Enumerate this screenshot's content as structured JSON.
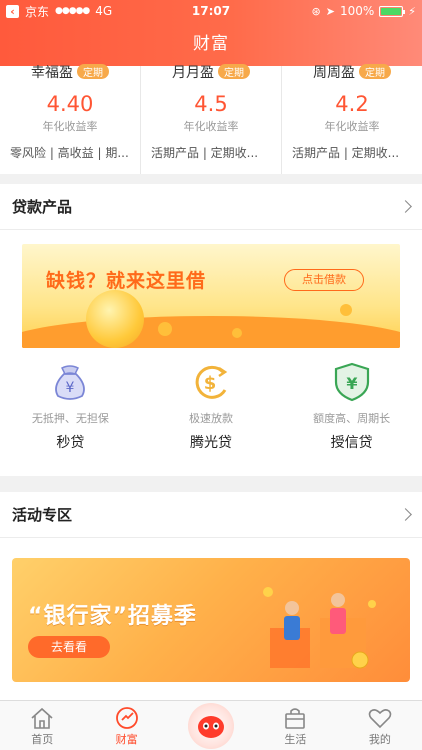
{
  "status_bar": {
    "carrier": "京东",
    "signal": "●●●●●",
    "network": "4G",
    "time": "17:07",
    "battery": "100%"
  },
  "header": {
    "title": "财富"
  },
  "products": [
    {
      "name": "幸福盈",
      "tag": "定期",
      "rate": "4.40",
      "rate_label": "年化收益率",
      "desc": "零风险 | 高收益 | 期..."
    },
    {
      "name": "月月盈",
      "tag": "定期",
      "rate": "4.5",
      "rate_label": "年化收益率",
      "desc": "活期产品 | 定期收..."
    },
    {
      "name": "周周盈",
      "tag": "定期",
      "rate": "4.2",
      "rate_label": "年化收益率",
      "desc": "活期产品 | 定期收..."
    }
  ],
  "loan_section": {
    "title": "贷款产品",
    "banner": {
      "text": "缺钱？就来这里借",
      "button": "点击借款"
    },
    "items": [
      {
        "sub": "无抵押、无担保",
        "name": "秒贷",
        "icon": "money-bag-icon"
      },
      {
        "sub": "极速放款",
        "name": "腾光贷",
        "icon": "dollar-arrow-icon"
      },
      {
        "sub": "额度高、周期长",
        "name": "授信贷",
        "icon": "shield-yuan-icon"
      }
    ]
  },
  "activity_section": {
    "title": "活动专区",
    "banner": {
      "text": "“银行家”招募季",
      "button": "去看看"
    }
  },
  "tabbar": {
    "items": [
      {
        "label": "首页",
        "icon": "home-icon"
      },
      {
        "label": "财富",
        "icon": "wealth-icon"
      },
      {
        "label": "",
        "icon": "mascot-icon"
      },
      {
        "label": "生活",
        "icon": "bag-icon"
      },
      {
        "label": "我的",
        "icon": "heart-icon"
      }
    ]
  },
  "colors": {
    "accent": "#ff5a3c",
    "rate": "#ff5533",
    "tag": "#f7a94a",
    "active_tab": "#ff4b2b"
  }
}
